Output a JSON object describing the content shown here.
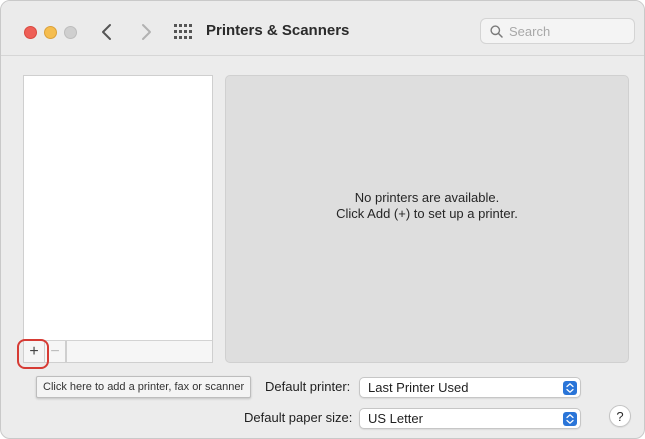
{
  "window": {
    "title": "Printers & Scanners"
  },
  "toolbar": {
    "back_icon": "chevron-left-icon",
    "forward_icon": "chevron-right-icon",
    "show_all_icon": "grid-icon",
    "search_placeholder": "Search"
  },
  "printer_list": {
    "items": [],
    "add_label": "+",
    "remove_label": "−"
  },
  "detail": {
    "message_line1": "No printers are available.",
    "message_line2": "Click Add (+) to set up a printer."
  },
  "tooltip": {
    "text": "Click here to add a printer, fax or scanner"
  },
  "defaults": {
    "printer_label": "Default printer:",
    "printer_value": "Last Printer Used",
    "paper_label": "Default paper size:",
    "paper_value": "US Letter"
  },
  "help": {
    "label": "?"
  },
  "colors": {
    "close": "#ee5f57",
    "minimize": "#f5bd4f",
    "zoom": "#cfcfcf",
    "accent": "#2a75d8",
    "highlight": "#d63b34"
  }
}
